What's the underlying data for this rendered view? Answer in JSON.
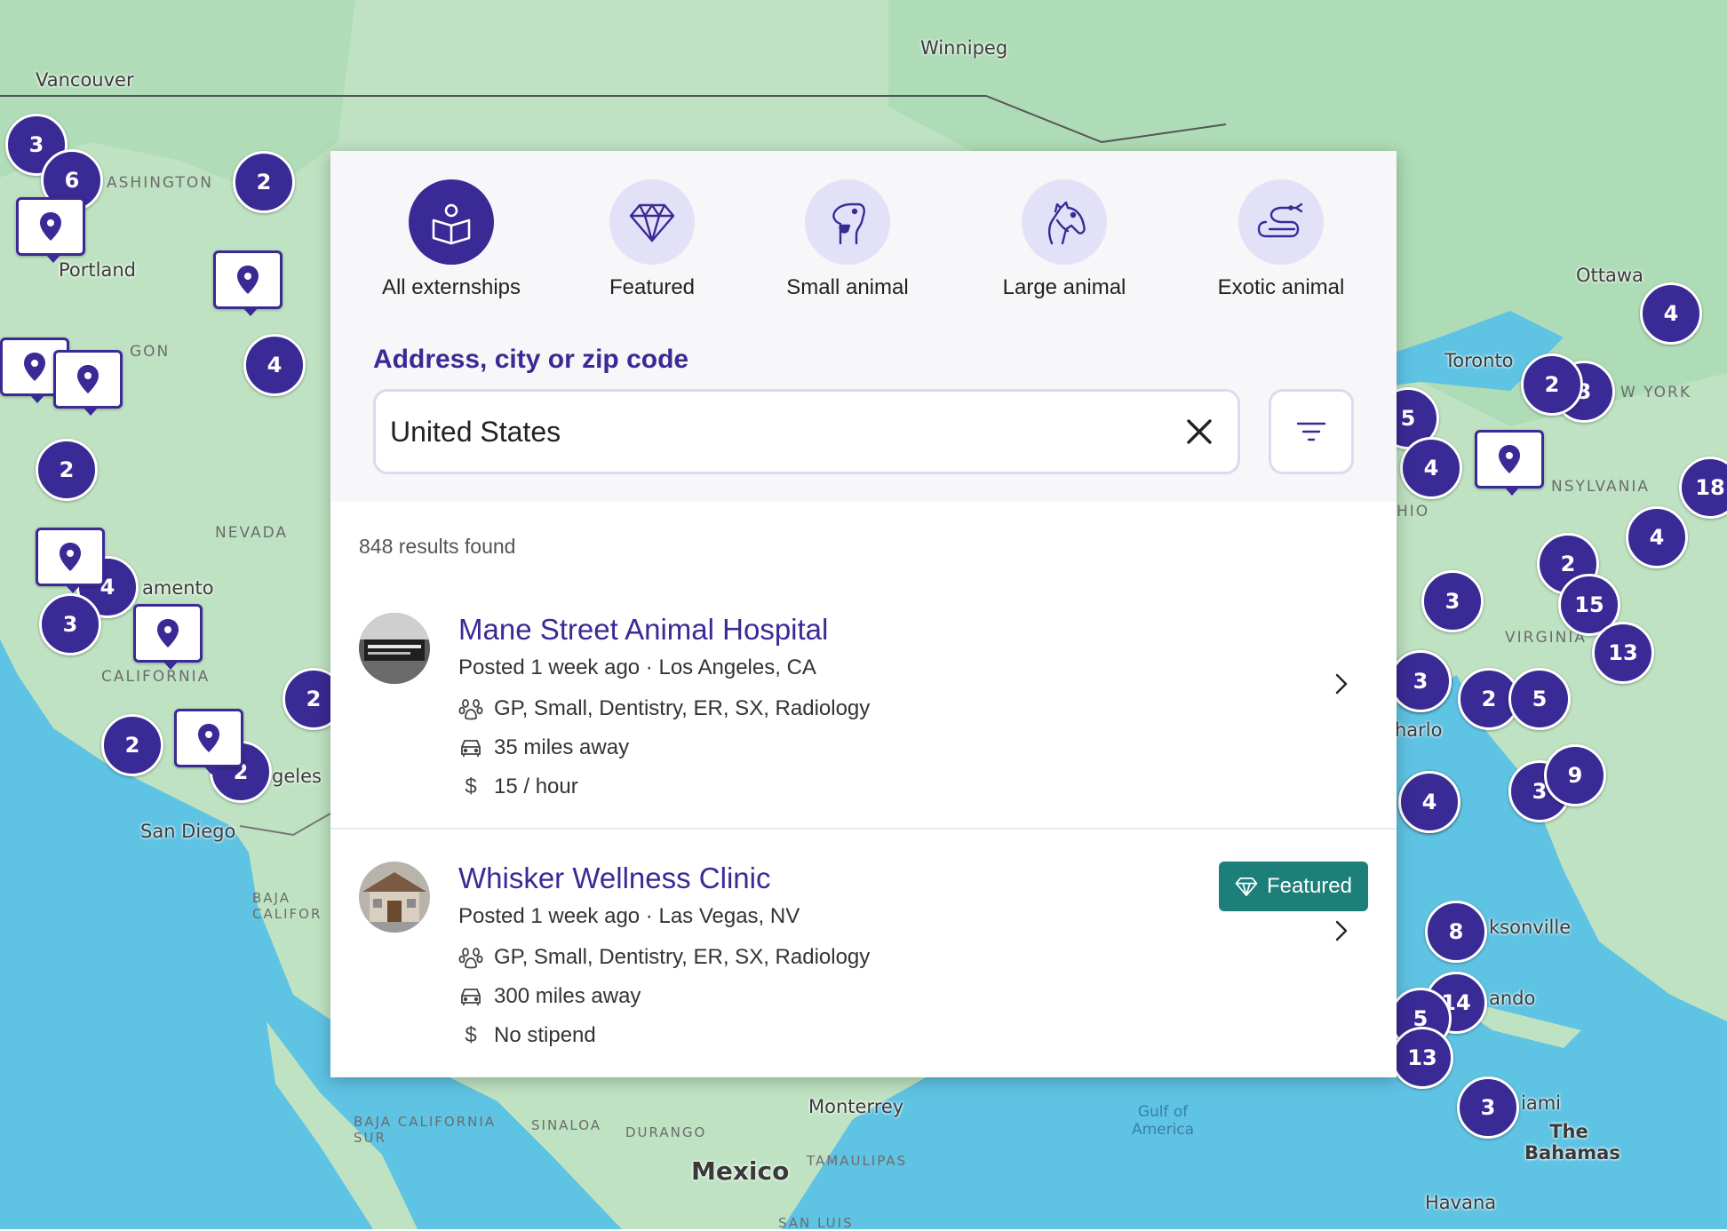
{
  "map": {
    "places": [
      {
        "id": "winnipeg",
        "label": "Winnipeg"
      },
      {
        "id": "vancouver",
        "label": "Vancouver"
      },
      {
        "id": "portland",
        "label": "Portland"
      },
      {
        "id": "washington",
        "label": "ASHINGTON"
      },
      {
        "id": "oregon",
        "label": "GON"
      },
      {
        "id": "nevada",
        "label": "NEVADA"
      },
      {
        "id": "sacramento",
        "label": "amento"
      },
      {
        "id": "california",
        "label": "CALIFORNIA"
      },
      {
        "id": "los-angeles",
        "label": "geles"
      },
      {
        "id": "san-diego",
        "label": "San Diego"
      },
      {
        "id": "baja-california",
        "label": "BAJA CALIFOR"
      },
      {
        "id": "baja-california-sur",
        "label": "BAJA CALIFORNIA SUR"
      },
      {
        "id": "sinaloa",
        "label": "SINALOA"
      },
      {
        "id": "durango",
        "label": "DURANGO"
      },
      {
        "id": "monterrey",
        "label": "Monterrey"
      },
      {
        "id": "mexico",
        "label": "Mexico"
      },
      {
        "id": "tamaulipas",
        "label": "TAMAULIPAS"
      },
      {
        "id": "san-luis",
        "label": "SAN LUIS"
      },
      {
        "id": "gulf",
        "label": "Gulf of America"
      },
      {
        "id": "ottawa",
        "label": "Ottawa"
      },
      {
        "id": "toronto",
        "label": "Toronto"
      },
      {
        "id": "new-york",
        "label": "W YORK"
      },
      {
        "id": "pennsylvania",
        "label": "NSYLVANIA"
      },
      {
        "id": "ohio",
        "label": "HIO"
      },
      {
        "id": "virginia",
        "label": "VIRGINIA"
      },
      {
        "id": "charlotte",
        "label": "harlo"
      },
      {
        "id": "jacksonville",
        "label": "ksonville"
      },
      {
        "id": "orlando",
        "label": "ando"
      },
      {
        "id": "miami",
        "label": "iami"
      },
      {
        "id": "bahamas",
        "label": "The Bahamas"
      },
      {
        "id": "havana",
        "label": "Havana"
      }
    ],
    "clusters": [
      "3",
      "6",
      "2",
      "4",
      "2",
      "4",
      "3",
      "2",
      "2",
      "2",
      "5",
      "4",
      "3",
      "2",
      "3",
      "4",
      "18",
      "4",
      "2",
      "15",
      "3",
      "13",
      "3",
      "2",
      "5",
      "4",
      "3",
      "9",
      "8",
      "14",
      "5",
      "13",
      "3",
      "4"
    ]
  },
  "categories": [
    {
      "label": "All externships",
      "icon": "book-person-icon",
      "active": true
    },
    {
      "label": "Featured",
      "icon": "diamond-icon",
      "active": false
    },
    {
      "label": "Small animal",
      "icon": "dog-icon",
      "active": false
    },
    {
      "label": "Large animal",
      "icon": "horse-icon",
      "active": false
    },
    {
      "label": "Exotic animal",
      "icon": "snake-icon",
      "active": false
    }
  ],
  "search": {
    "label": "Address, city or zip code",
    "value": "United States"
  },
  "results": {
    "count_text": "848 results found",
    "items": [
      {
        "title": "Mane Street Animal Hospital",
        "posted": "Posted 1 week ago · Los Angeles, CA",
        "specialties": "GP, Small, Dentistry, ER, SX, Radiology",
        "distance": "35 miles away",
        "stipend": "15 / hour",
        "featured": false
      },
      {
        "title": "Whisker Wellness Clinic",
        "posted": "Posted 1 week ago · Las Vegas, NV",
        "specialties": "GP, Small, Dentistry, ER, SX, Radiology",
        "distance": "300 miles away",
        "stipend": "No stipend",
        "featured": true,
        "badge": "Featured"
      }
    ]
  },
  "colors": {
    "brand": "#3a2a95",
    "featured": "#1d7f7a",
    "water": "#5fc3e4",
    "land": "#bfe3c2"
  }
}
